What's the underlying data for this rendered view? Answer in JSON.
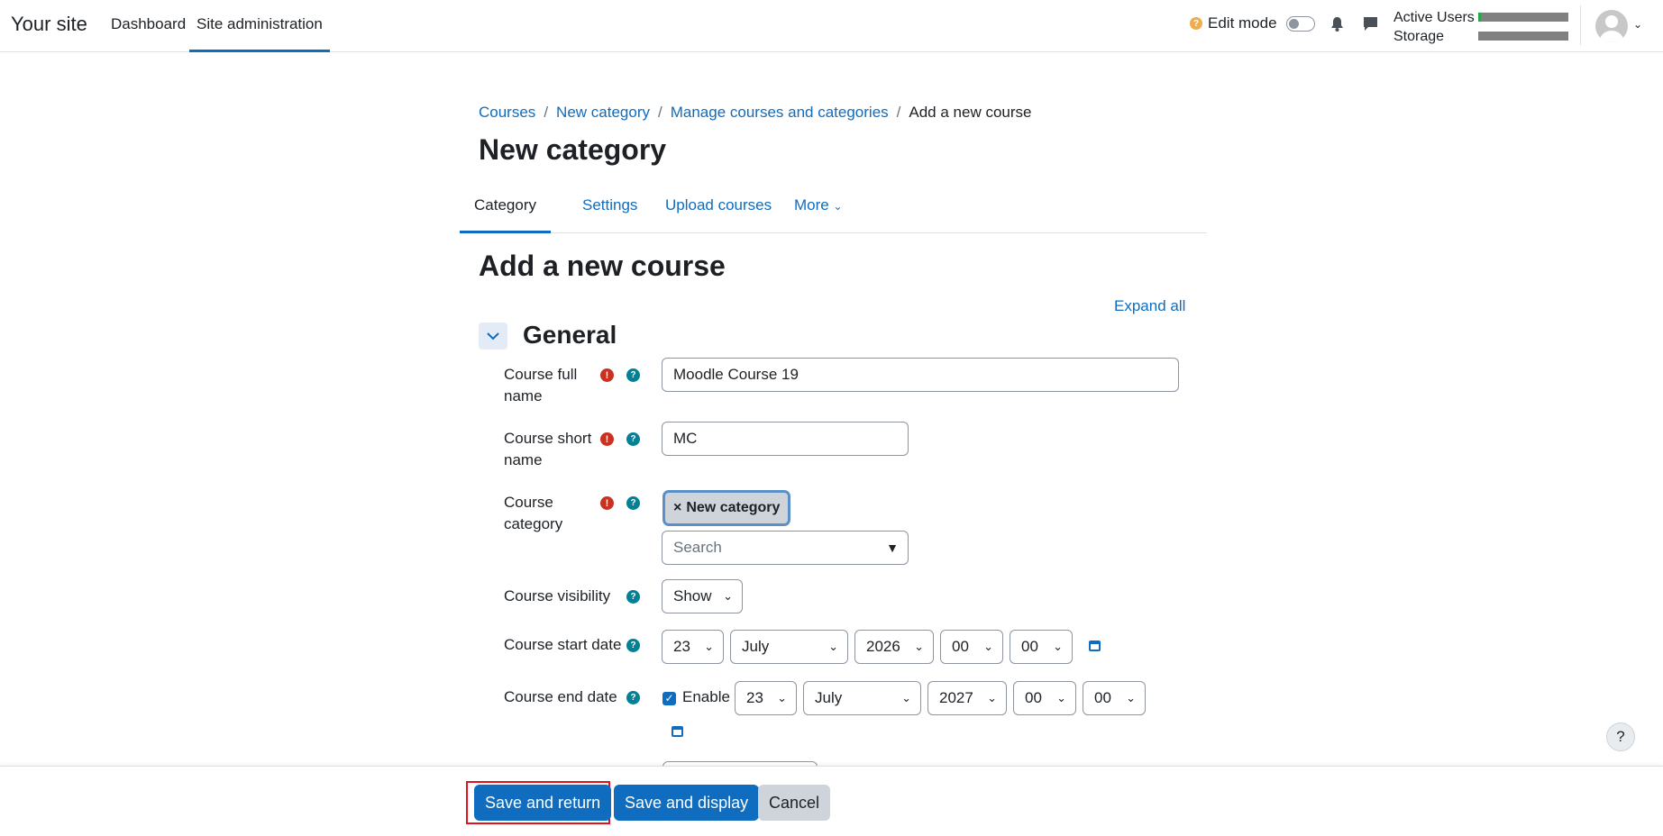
{
  "navbar": {
    "brand": "Your site",
    "items": [
      {
        "label": "Dashboard"
      },
      {
        "label": "Site administration"
      }
    ],
    "edit_mode_label": "Edit mode",
    "usage": {
      "active_users": "Active Users",
      "storage": "Storage"
    }
  },
  "breadcrumb": [
    "Courses",
    "New category",
    "Manage courses and categories",
    "Add a new course"
  ],
  "page_title": "New category",
  "tabs": [
    {
      "label": "Category"
    },
    {
      "label": "Settings"
    },
    {
      "label": "Upload courses"
    },
    {
      "label": "More"
    }
  ],
  "form": {
    "title": "Add a new course",
    "expand_all": "Expand all",
    "section": "General",
    "fullname_label": "Course full name",
    "fullname_value": "Moodle Course 19",
    "shortname_label": "Course short name",
    "shortname_value": "MC",
    "category_label": "Course category",
    "category_tag": "New category",
    "category_search_placeholder": "Search",
    "visibility_label": "Course visibility",
    "visibility_value": "Show",
    "start_label": "Course start date",
    "start": {
      "day": "23",
      "month": "July",
      "year": "2026",
      "hour": "00",
      "minute": "00"
    },
    "end_label": "Course end date",
    "end_enable": "Enable",
    "end": {
      "day": "23",
      "month": "July",
      "year": "2027",
      "hour": "00",
      "minute": "00"
    }
  },
  "footer": {
    "save_return": "Save and return",
    "save_display": "Save and display",
    "cancel": "Cancel"
  },
  "help_button": "?",
  "colors": {
    "primary": "#0f6cbf",
    "required": "#ca3120",
    "help": "#008196",
    "highlight": "#e0141e"
  }
}
